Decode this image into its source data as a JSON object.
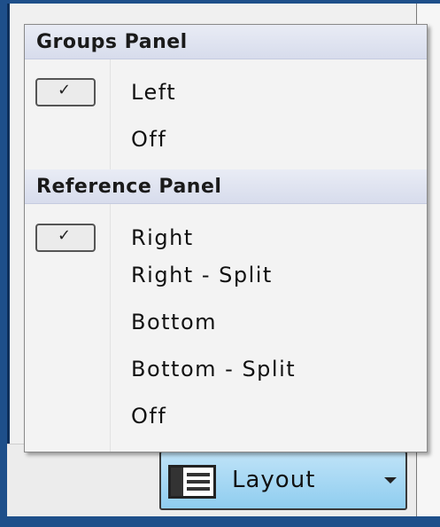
{
  "menu": {
    "sections": [
      {
        "header": "Groups Panel",
        "items": [
          {
            "label": "Left",
            "checked": true
          },
          {
            "label": "Off",
            "checked": false
          }
        ]
      },
      {
        "header": "Reference Panel",
        "items": [
          {
            "label": "Right",
            "checked": true
          },
          {
            "label": "Right - Split",
            "checked": false
          },
          {
            "label": "Bottom",
            "checked": false
          },
          {
            "label": "Bottom - Split",
            "checked": false
          },
          {
            "label": "Off",
            "checked": false
          }
        ]
      }
    ],
    "check_glyph": "✓"
  },
  "toolbar": {
    "layout_label": "Layout",
    "layout_icon": "layout-panels-icon",
    "dropdown_icon": "chevron-down-icon"
  },
  "colors": {
    "window_frame": "#1e4f8a",
    "button_highlight": "#8fcdef",
    "section_header_bg": "#d7dcec"
  }
}
